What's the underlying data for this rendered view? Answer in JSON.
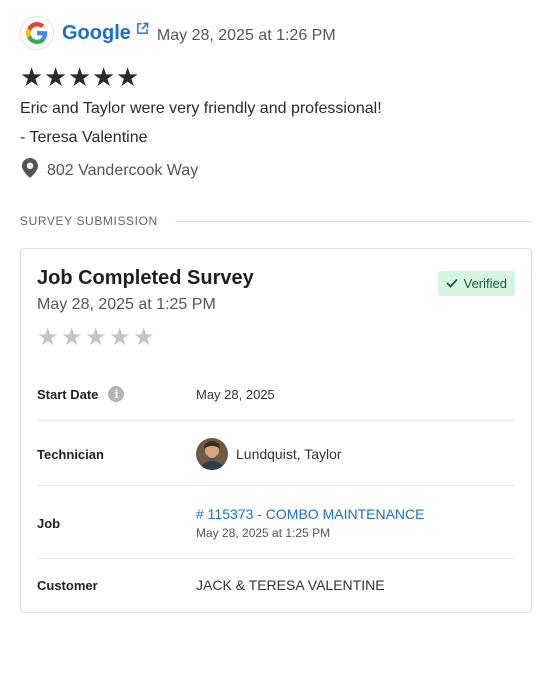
{
  "review": {
    "source": "Google",
    "date": "May 28, 2025 at 1:26 PM",
    "rating": 5,
    "text": "Eric and Taylor were very friendly and professional!",
    "author": "- Teresa Valentine",
    "location": "802 Vandercook Way",
    "icons": {
      "logo": "google-logo",
      "external": "external-link-icon",
      "star": "star-icon",
      "location": "map-pin-icon"
    },
    "colors": {
      "link": "#1a6fc6",
      "star": "#2c2c2c"
    }
  },
  "section": {
    "label": "SURVEY SUBMISSION"
  },
  "survey": {
    "title": "Job Completed Survey",
    "date": "May 28, 2025 at 1:25 PM",
    "badge": "Verified",
    "rating": 0,
    "star_color": "#c4c4c4",
    "badge_colors": {
      "bg": "#d6f5e3",
      "text": "#1c5c34"
    },
    "rows": {
      "start_date": {
        "label": "Start Date",
        "value": "May 28, 2025"
      },
      "technician": {
        "label": "Technician",
        "value": "Lundquist, Taylor"
      },
      "job": {
        "label": "Job",
        "link": "# 115373 - COMBO MAINTENANCE",
        "sub": "May 28, 2025 at 1:25 PM"
      },
      "customer": {
        "label": "Customer",
        "value": "JACK & TERESA VALENTINE"
      }
    }
  }
}
